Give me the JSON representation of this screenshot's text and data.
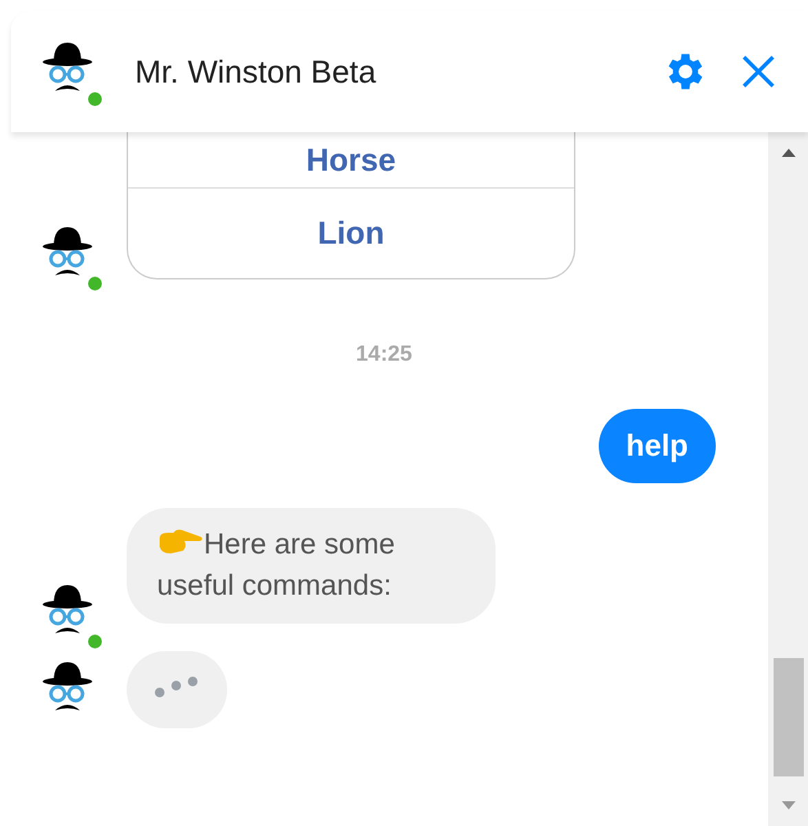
{
  "header": {
    "title": "Mr. Winston Beta",
    "online": true
  },
  "messages": [
    {
      "kind": "quick_replies",
      "online": true,
      "options": [
        "Horse",
        "Lion"
      ]
    },
    {
      "kind": "timestamp",
      "text": "14:25"
    },
    {
      "kind": "outgoing",
      "text": "help"
    },
    {
      "kind": "incoming",
      "online": true,
      "pointer": true,
      "text": "Here are some useful commands:"
    },
    {
      "kind": "typing",
      "online": false
    }
  ]
}
